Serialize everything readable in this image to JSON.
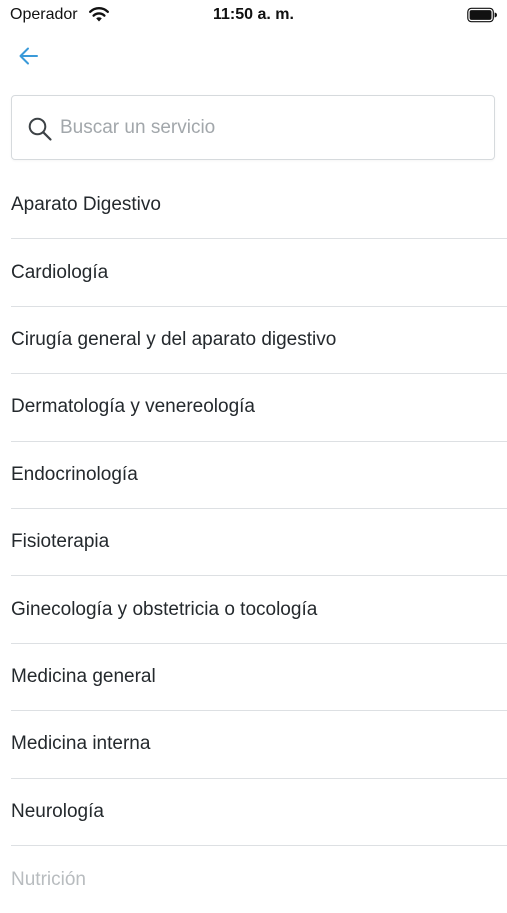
{
  "status_bar": {
    "carrier": "Operador",
    "time": "11:50 a. m."
  },
  "nav": {
    "back_icon": "arrow-left-icon",
    "accent_color": "#3a9ad9"
  },
  "search": {
    "icon": "search-icon",
    "placeholder": "Buscar un servicio",
    "value": ""
  },
  "services": [
    "Aparato Digestivo",
    "Cardiología",
    "Cirugía general y del aparato digestivo",
    "Dermatología y venereología",
    "Endocrinología",
    "Fisioterapia",
    "Ginecología y obstetricia o tocología",
    "Medicina general",
    "Medicina interna",
    "Neurología",
    "Nutrición"
  ]
}
